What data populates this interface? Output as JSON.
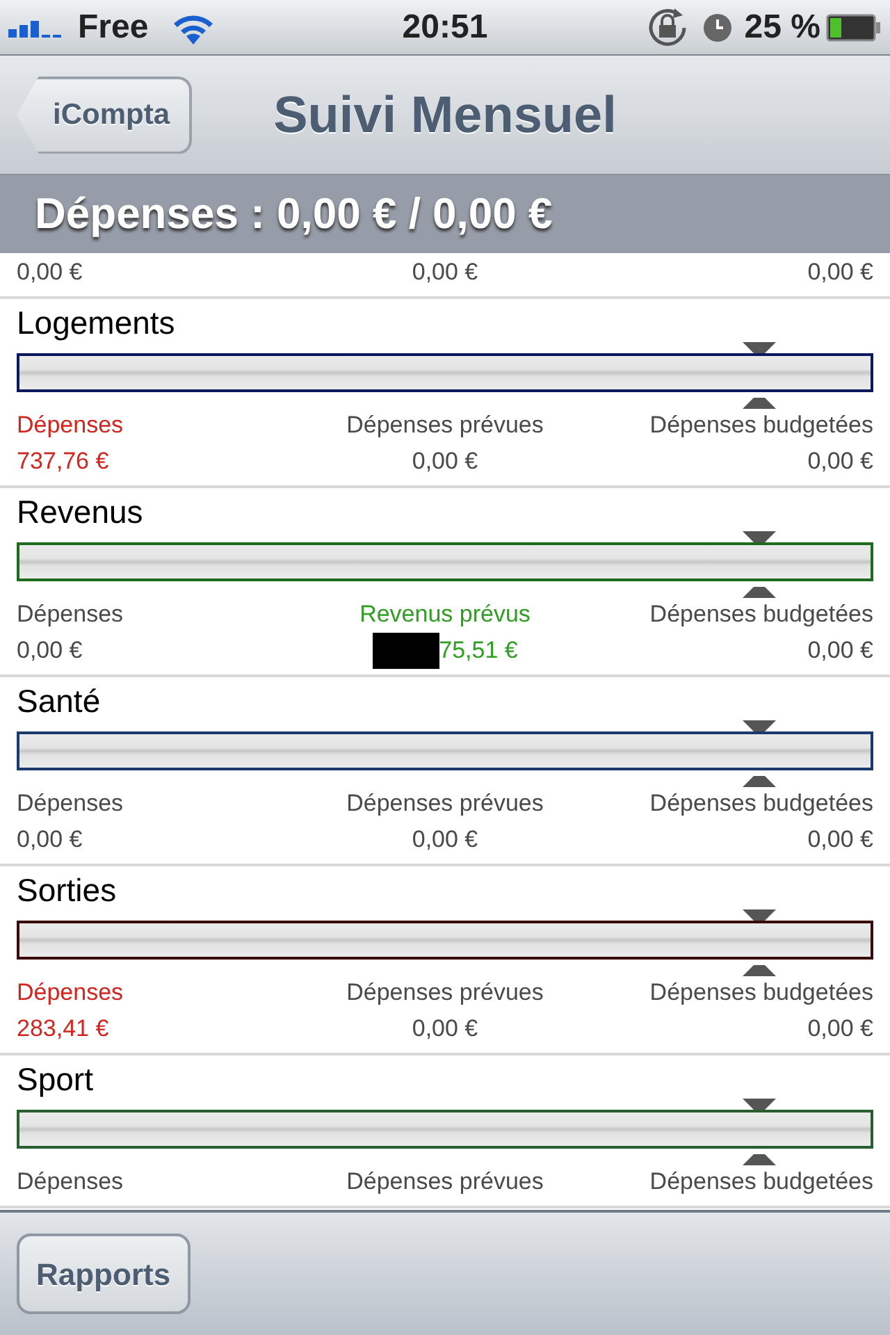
{
  "status_bar": {
    "carrier": "Free",
    "time": "20:51",
    "battery": "25 %"
  },
  "nav_bar": {
    "back_button": "iCompta",
    "title": "Suivi Mensuel"
  },
  "summary": "Dépenses : 0,00 € / 0,00 €",
  "categories": [
    {
      "stats": [
        {
          "value": "0,00 €",
          "color": "#4a4a4a"
        },
        {
          "value": "0,00 €",
          "color": "#4a4a4a"
        },
        {
          "value": "0,00 €",
          "color": "#4a4a4a"
        }
      ]
    },
    {
      "name": "Logements",
      "color": "#0b1a5e",
      "level": 0.87,
      "stats": [
        {
          "label": "Dépenses",
          "value": "737,76 €",
          "color": "#d0261f"
        },
        {
          "label": "Dépenses prévues",
          "value": "0,00 €",
          "color": "#4a4a4a"
        },
        {
          "label": "Dépenses budgetées",
          "value": "0,00 €",
          "color": "#4a4a4a"
        }
      ]
    },
    {
      "name": "Revenus",
      "color": "#1e6b1e",
      "level": 0.87,
      "stats": [
        {
          "label": "Dépenses",
          "value": "0,00 €",
          "color": "#4a4a4a"
        },
        {
          "label": "Revenus prévus",
          "value": "75,51 €",
          "color": "#2f9e22",
          "redacted": true
        },
        {
          "label": "Dépenses budgetées",
          "value": "0,00 €",
          "color": "#4a4a4a"
        }
      ]
    },
    {
      "name": "Santé",
      "color": "#1c3a6e",
      "level": 0.87,
      "stats": [
        {
          "label": "Dépenses",
          "value": "0,00 €",
          "color": "#4a4a4a"
        },
        {
          "label": "Dépenses prévues",
          "value": "0,00 €",
          "color": "#4a4a4a"
        },
        {
          "label": "Dépenses budgetées",
          "value": "0,00 €",
          "color": "#4a4a4a"
        }
      ]
    },
    {
      "name": "Sorties",
      "color": "#3a0d0d",
      "level": 0.87,
      "stats": [
        {
          "label": "Dépenses",
          "value": "283,41 €",
          "color": "#d0261f"
        },
        {
          "label": "Dépenses prévues",
          "value": "0,00 €",
          "color": "#4a4a4a"
        },
        {
          "label": "Dépenses budgetées",
          "value": "0,00 €",
          "color": "#4a4a4a"
        }
      ]
    },
    {
      "name": "Sport",
      "color": "#2a5e30",
      "level": 0.87,
      "stats": [
        {
          "label": "Dépenses",
          "color": "#4a4a4a"
        },
        {
          "label": "Dépenses prévues",
          "color": "#4a4a4a"
        },
        {
          "label": "Dépenses budgetées",
          "color": "#4a4a4a"
        }
      ]
    }
  ],
  "toolbar": {
    "button": "Rapports"
  }
}
